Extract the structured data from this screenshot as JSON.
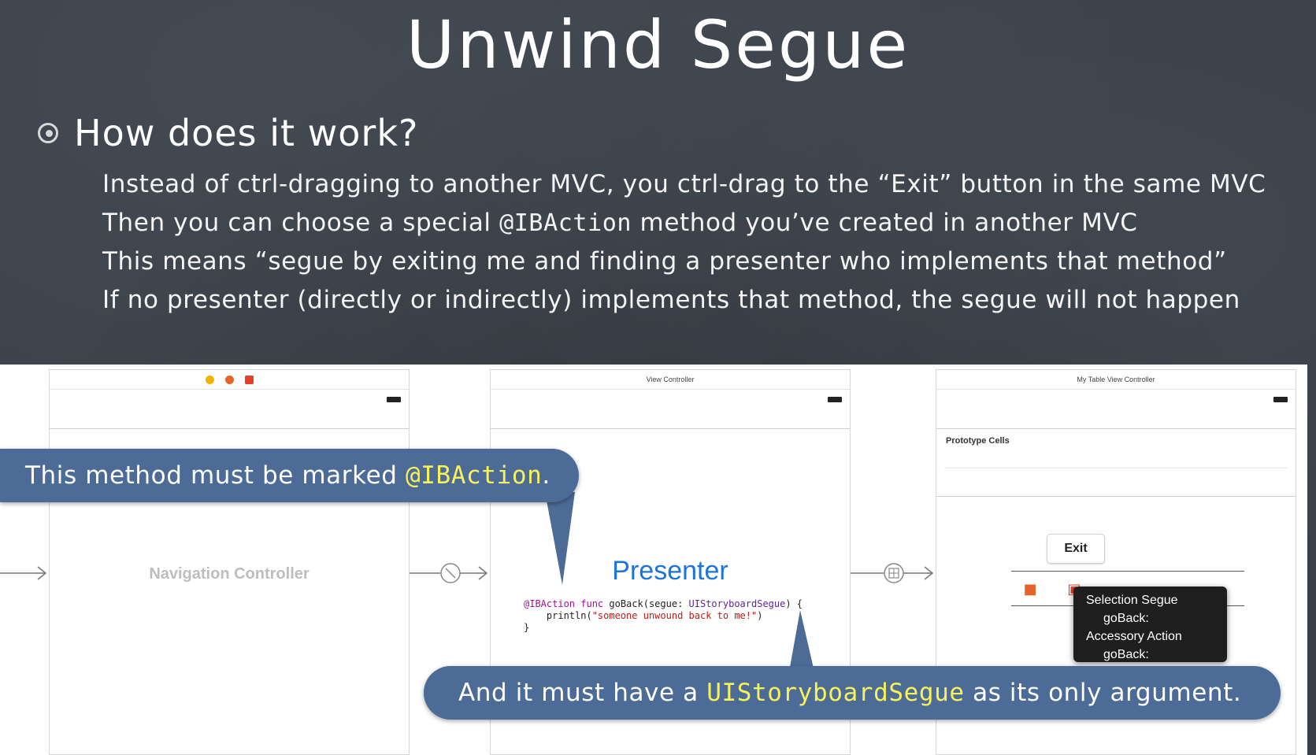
{
  "slide": {
    "title": "Unwind Segue",
    "heading": "How does it work?",
    "points": {
      "p1": "Instead of ctrl-dragging to another MVC, you ctrl-drag to the “Exit” button in the same MVC",
      "p2_before": "Then you can choose a special ",
      "p2_code": "@IBAction",
      "p2_after": " method you’ve created in another MVC",
      "p3": "This means “segue by exiting me and finding a presenter who implements that method”",
      "p4": "If no presenter (directly or indirectly) implements that method, the segue will not happen"
    }
  },
  "storyboard": {
    "nav_scene": {
      "label": "Navigation Controller",
      "dot_colors": [
        "#f0b400",
        "#e8632a",
        "#e3402a"
      ]
    },
    "view_scene": {
      "header": "View Controller",
      "presenter": "Presenter",
      "code": {
        "l1_kw": "@IBAction func",
        "l1_mid": " goBack(segue: ",
        "l1_type": "UIStoryboardSegue",
        "l1_end": ") {",
        "l2_start": "    println(",
        "l2_str": "\"someone unwound back to me!\"",
        "l2_end": ")",
        "l3": "}"
      }
    },
    "table_scene": {
      "header": "My Table View Controller",
      "prototype_label": "Prototype Cells",
      "exit_button": "Exit",
      "popup": {
        "item1": "Selection Segue",
        "item2": "goBack:",
        "item3": "Accessory Action",
        "item4": "goBack:"
      }
    }
  },
  "callouts": {
    "top": {
      "before": "This method must be marked ",
      "highlight": "@IBAction",
      "after": "."
    },
    "bottom": {
      "before": "And it must have a ",
      "highlight": "UIStoryboardSegue",
      "after": " as its only argument."
    }
  },
  "colors": {
    "callout_bg": "#4d6b97",
    "highlight": "#f7f25a",
    "presenter_blue": "#1c73d8"
  }
}
